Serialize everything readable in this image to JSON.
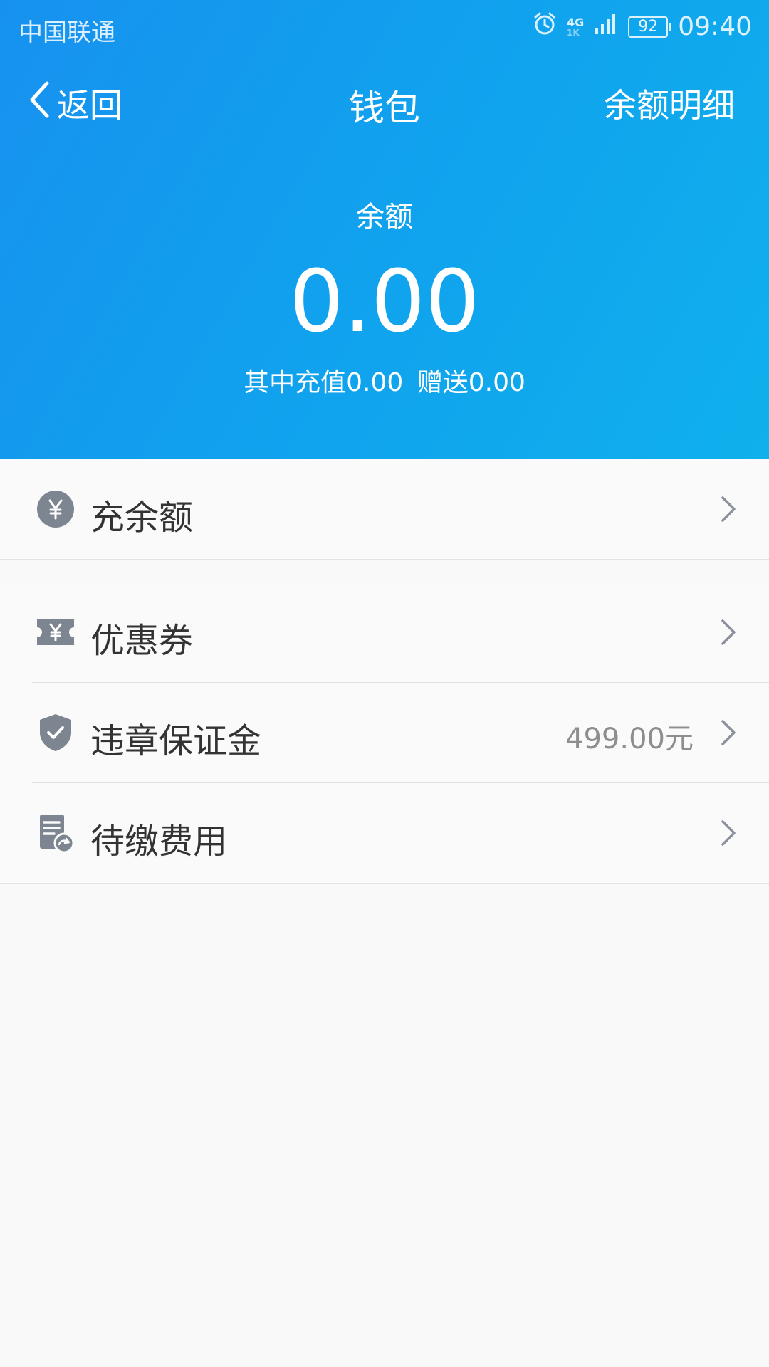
{
  "status_bar": {
    "carrier": "中国联通",
    "network_top": "4G",
    "network_bottom": "1K",
    "battery": "92",
    "time": "09:40"
  },
  "nav": {
    "back_label": "返回",
    "title": "钱包",
    "right_label": "余额明细"
  },
  "balance": {
    "label": "余额",
    "amount": "0.00",
    "recharge_text": "其中充值0.00",
    "bonus_text": "赠送0.00"
  },
  "menu": {
    "recharge": {
      "label": "充余额",
      "icon": "yen-coin-icon"
    },
    "coupons": {
      "label": "优惠券",
      "icon": "coupon-ticket-icon"
    },
    "deposit": {
      "label": "违章保证金",
      "value": "499.00元",
      "icon": "shield-check-icon"
    },
    "pending_fees": {
      "label": "待缴费用",
      "icon": "bill-document-icon"
    }
  },
  "colors": {
    "header_start": "#1791ef",
    "header_end": "#0fb0ec",
    "icon_gray": "#7d8590",
    "chevron_gray": "#8a919c"
  }
}
